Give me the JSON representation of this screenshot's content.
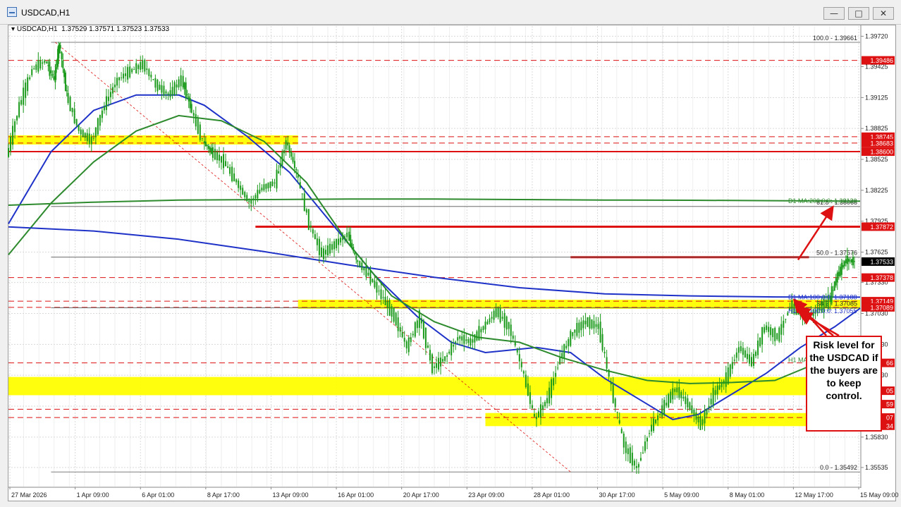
{
  "window": {
    "title": "USDCAD,H1",
    "buttons": {
      "minimize": "—",
      "maximize": "□",
      "close": "✕"
    }
  },
  "chart_header": {
    "symbol": "USDCAD,H1",
    "ohlc": "1.37529 1.37571 1.37523 1.37533"
  },
  "colors": {
    "candle": "#1a9a1a",
    "ma_blue": "#1f32c8",
    "ma_green": "#2d8a2d",
    "support": "#ffff00",
    "level_red": "#dd1111",
    "current_price_bg": "#000000",
    "grid": "#dadada"
  },
  "chart_data": {
    "type": "line",
    "subtype": "candlestick",
    "symbol": "USDCAD",
    "timeframe": "H1",
    "ylim": [
      1.3535,
      1.3975
    ],
    "price_axis_ticks": [
      "1.39720",
      "1.39425",
      "1.39125",
      "1.38825",
      "1.38525",
      "1.38225",
      "1.37925",
      "1.37625",
      "1.37330",
      "1.37030",
      "1.36730",
      "1.36430",
      "1.36130",
      "1.35830",
      "1.35535"
    ],
    "time_labels": [
      "27 Mar 2026",
      "1 Apr 09:00",
      "6 Apr 01:00",
      "8 Apr 17:00",
      "13 Apr 09:00",
      "16 Apr 01:00",
      "20 Apr 17:00",
      "23 Apr 09:00",
      "28 Apr 01:00",
      "30 Apr 17:00",
      "5 May 09:00",
      "8 May 01:00",
      "12 May 17:00",
      "15 May 09:00"
    ],
    "price_series": [
      {
        "t": 0,
        "p": 1.3855
      },
      {
        "t": 0.015,
        "p": 1.3905
      },
      {
        "t": 0.03,
        "p": 1.394
      },
      {
        "t": 0.045,
        "p": 1.3948
      },
      {
        "t": 0.055,
        "p": 1.393
      },
      {
        "t": 0.061,
        "p": 1.3966
      },
      {
        "t": 0.07,
        "p": 1.3915
      },
      {
        "t": 0.085,
        "p": 1.388
      },
      {
        "t": 0.1,
        "p": 1.387
      },
      {
        "t": 0.115,
        "p": 1.3905
      },
      {
        "t": 0.13,
        "p": 1.393
      },
      {
        "t": 0.145,
        "p": 1.3938
      },
      {
        "t": 0.16,
        "p": 1.3945
      },
      {
        "t": 0.175,
        "p": 1.3925
      },
      {
        "t": 0.19,
        "p": 1.3915
      },
      {
        "t": 0.205,
        "p": 1.393
      },
      {
        "t": 0.215,
        "p": 1.3905
      },
      {
        "t": 0.23,
        "p": 1.387
      },
      {
        "t": 0.24,
        "p": 1.386
      },
      {
        "t": 0.255,
        "p": 1.385
      },
      {
        "t": 0.27,
        "p": 1.383
      },
      {
        "t": 0.285,
        "p": 1.381
      },
      {
        "t": 0.3,
        "p": 1.3825
      },
      {
        "t": 0.315,
        "p": 1.383
      },
      {
        "t": 0.328,
        "p": 1.387
      },
      {
        "t": 0.34,
        "p": 1.384
      },
      {
        "t": 0.355,
        "p": 1.379
      },
      {
        "t": 0.37,
        "p": 1.376
      },
      {
        "t": 0.385,
        "p": 1.377
      },
      {
        "t": 0.4,
        "p": 1.378
      },
      {
        "t": 0.41,
        "p": 1.3755
      },
      {
        "t": 0.425,
        "p": 1.374
      },
      {
        "t": 0.44,
        "p": 1.372
      },
      {
        "t": 0.455,
        "p": 1.37
      },
      {
        "t": 0.47,
        "p": 1.367
      },
      {
        "t": 0.485,
        "p": 1.37
      },
      {
        "t": 0.5,
        "p": 1.365
      },
      {
        "t": 0.515,
        "p": 1.366
      },
      {
        "t": 0.53,
        "p": 1.368
      },
      {
        "t": 0.545,
        "p": 1.3675
      },
      {
        "t": 0.56,
        "p": 1.369
      },
      {
        "t": 0.575,
        "p": 1.3705
      },
      {
        "t": 0.59,
        "p": 1.369
      },
      {
        "t": 0.605,
        "p": 1.365
      },
      {
        "t": 0.62,
        "p": 1.36
      },
      {
        "t": 0.635,
        "p": 1.362
      },
      {
        "t": 0.65,
        "p": 1.366
      },
      {
        "t": 0.665,
        "p": 1.3685
      },
      {
        "t": 0.68,
        "p": 1.3695
      },
      {
        "t": 0.695,
        "p": 1.369
      },
      {
        "t": 0.71,
        "p": 1.363
      },
      {
        "t": 0.725,
        "p": 1.3575
      },
      {
        "t": 0.74,
        "p": 1.3552
      },
      {
        "t": 0.755,
        "p": 1.359
      },
      {
        "t": 0.77,
        "p": 1.361
      },
      {
        "t": 0.785,
        "p": 1.363
      },
      {
        "t": 0.8,
        "p": 1.3615
      },
      {
        "t": 0.815,
        "p": 1.3595
      },
      {
        "t": 0.83,
        "p": 1.3625
      },
      {
        "t": 0.845,
        "p": 1.364
      },
      {
        "t": 0.86,
        "p": 1.367
      },
      {
        "t": 0.875,
        "p": 1.3655
      },
      {
        "t": 0.89,
        "p": 1.369
      },
      {
        "t": 0.905,
        "p": 1.368
      },
      {
        "t": 0.92,
        "p": 1.371
      },
      {
        "t": 0.935,
        "p": 1.37
      },
      {
        "t": 0.95,
        "p": 1.3705
      },
      {
        "t": 0.965,
        "p": 1.3715
      },
      {
        "t": 0.975,
        "p": 1.374
      },
      {
        "t": 0.985,
        "p": 1.3755
      },
      {
        "t": 0.995,
        "p": 1.37533
      }
    ],
    "moving_averages": [
      {
        "name": "H1 MA:100",
        "color": "#1f32c8",
        "points": [
          {
            "t": 0,
            "p": 1.379
          },
          {
            "t": 0.05,
            "p": 1.386
          },
          {
            "t": 0.1,
            "p": 1.39
          },
          {
            "t": 0.15,
            "p": 1.3915
          },
          {
            "t": 0.2,
            "p": 1.3915
          },
          {
            "t": 0.23,
            "p": 1.3905
          },
          {
            "t": 0.28,
            "p": 1.3875
          },
          {
            "t": 0.33,
            "p": 1.384
          },
          {
            "t": 0.38,
            "p": 1.379
          },
          {
            "t": 0.43,
            "p": 1.374
          },
          {
            "t": 0.48,
            "p": 1.37
          },
          {
            "t": 0.52,
            "p": 1.3675
          },
          {
            "t": 0.56,
            "p": 1.3665
          },
          {
            "t": 0.62,
            "p": 1.367
          },
          {
            "t": 0.66,
            "p": 1.3665
          },
          {
            "t": 0.7,
            "p": 1.364
          },
          {
            "t": 0.74,
            "p": 1.362
          },
          {
            "t": 0.78,
            "p": 1.36
          },
          {
            "t": 0.81,
            "p": 1.3605
          },
          {
            "t": 0.85,
            "p": 1.3625
          },
          {
            "t": 0.89,
            "p": 1.3645
          },
          {
            "t": 0.93,
            "p": 1.367
          },
          {
            "t": 0.97,
            "p": 1.369
          },
          {
            "t": 1,
            "p": 1.3708
          }
        ]
      },
      {
        "name": "H1 MA:200",
        "color": "#2d8a2d",
        "points": [
          {
            "t": 0,
            "p": 1.376
          },
          {
            "t": 0.05,
            "p": 1.381
          },
          {
            "t": 0.1,
            "p": 1.385
          },
          {
            "t": 0.15,
            "p": 1.388
          },
          {
            "t": 0.2,
            "p": 1.3895
          },
          {
            "t": 0.25,
            "p": 1.389
          },
          {
            "t": 0.3,
            "p": 1.387
          },
          {
            "t": 0.35,
            "p": 1.383
          },
          {
            "t": 0.4,
            "p": 1.377
          },
          {
            "t": 0.45,
            "p": 1.372
          },
          {
            "t": 0.5,
            "p": 1.3695
          },
          {
            "t": 0.55,
            "p": 1.368
          },
          {
            "t": 0.6,
            "p": 1.3675
          },
          {
            "t": 0.65,
            "p": 1.366
          },
          {
            "t": 0.7,
            "p": 1.3648
          },
          {
            "t": 0.75,
            "p": 1.3638
          },
          {
            "t": 0.8,
            "p": 1.3635
          },
          {
            "t": 0.85,
            "p": 1.3636
          },
          {
            "t": 0.9,
            "p": 1.3638
          },
          {
            "t": 0.95,
            "p": 1.3655
          },
          {
            "t": 1,
            "p": 1.368
          }
        ]
      },
      {
        "name": "D1 MA:100",
        "color": "#1f32c8",
        "points": [
          {
            "t": 0,
            "p": 1.3787
          },
          {
            "t": 0.1,
            "p": 1.3783
          },
          {
            "t": 0.2,
            "p": 1.3775
          },
          {
            "t": 0.3,
            "p": 1.3763
          },
          {
            "t": 0.4,
            "p": 1.375
          },
          {
            "t": 0.5,
            "p": 1.3738
          },
          {
            "t": 0.6,
            "p": 1.3728
          },
          {
            "t": 0.7,
            "p": 1.3722
          },
          {
            "t": 0.8,
            "p": 1.372
          },
          {
            "t": 0.9,
            "p": 1.3719
          },
          {
            "t": 1,
            "p": 1.37188
          }
        ]
      },
      {
        "name": "D1 MA:200",
        "color": "#2d8a2d",
        "points": [
          {
            "t": 0,
            "p": 1.3808
          },
          {
            "t": 0.1,
            "p": 1.3811
          },
          {
            "t": 0.2,
            "p": 1.3813
          },
          {
            "t": 0.3,
            "p": 1.38135
          },
          {
            "t": 0.4,
            "p": 1.3814
          },
          {
            "t": 0.5,
            "p": 1.3814
          },
          {
            "t": 0.6,
            "p": 1.38135
          },
          {
            "t": 0.7,
            "p": 1.3813
          },
          {
            "t": 0.8,
            "p": 1.38128
          },
          {
            "t": 0.9,
            "p": 1.38124
          },
          {
            "t": 1,
            "p": 1.3812
          }
        ]
      }
    ],
    "support_zones": [
      {
        "from": 1.38683,
        "to": 1.38745,
        "t_from": 0,
        "t_to": 0.34
      },
      {
        "from": 1.37089,
        "to": 1.37149,
        "t_from": 0.34,
        "t_to": 1
      },
      {
        "from": 1.3625,
        "to": 1.364,
        "t_from": 0,
        "t_to": 1
      },
      {
        "from": 1.3595,
        "to": 1.3605,
        "t_from": 0.56,
        "t_to": 1
      }
    ],
    "horizontal_lines": [
      {
        "price": 1.39486,
        "style": "dash",
        "color": "#dd1111",
        "t_from": 0,
        "t_to": 1
      },
      {
        "price": 1.38745,
        "style": "dash",
        "color": "#dd1111",
        "t_from": 0,
        "t_to": 1
      },
      {
        "price": 1.38683,
        "style": "dash",
        "color": "#dd1111",
        "t_from": 0,
        "t_to": 1
      },
      {
        "price": 1.386,
        "style": "solid",
        "color": "#dd1111",
        "t_from": 0,
        "t_to": 1
      },
      {
        "price": 1.37872,
        "style": "thick",
        "color": "#dd1111",
        "t_from": 0.29,
        "t_to": 1
      },
      {
        "price": 1.37576,
        "style": "thick",
        "color": "#dd1111",
        "t_from": 0.66,
        "t_to": 0.94
      },
      {
        "price": 1.37378,
        "style": "dash",
        "color": "#dd1111",
        "t_from": 0,
        "t_to": 1
      },
      {
        "price": 1.37149,
        "style": "dash",
        "color": "#dd1111",
        "t_from": 0,
        "t_to": 1
      },
      {
        "price": 1.37089,
        "style": "dash",
        "color": "#dd1111",
        "t_from": 0,
        "t_to": 1
      },
      {
        "price": 1.3655,
        "style": "dash",
        "color": "#dd1111",
        "t_from": 0,
        "t_to": 1
      },
      {
        "price": 1.361,
        "style": "dash",
        "color": "#dd1111",
        "t_from": 0,
        "t_to": 1
      },
      {
        "price": 1.3602,
        "style": "dash",
        "color": "#dd1111",
        "t_from": 0,
        "t_to": 1
      }
    ],
    "fibonacci": [
      {
        "price": 1.39661,
        "label": "100.0 - 1.39661"
      },
      {
        "price": 1.38068,
        "label": "61.8 - 1.38068"
      },
      {
        "price": 1.37576,
        "label": "50.0 - 1.37576"
      },
      {
        "price": 1.37085,
        "label": "38.2 - 1.37085"
      },
      {
        "price": 1.35492,
        "label": "0.0 - 1.35492"
      }
    ],
    "ma_labels": [
      {
        "text": "D1 MA:200:0:0: 1.38120",
        "price": 1.3812,
        "color": "#2d8a2d"
      },
      {
        "text": "D1 MA:100:0:0: 1.37188",
        "price": 1.37188,
        "color": "#1f32c8"
      },
      {
        "text": "H1 MA:100:0:0: 1.37055",
        "price": 1.37055,
        "color": "#1f32c8"
      },
      {
        "text": "H1 MA",
        "price": 1.3658,
        "color": "#2d8a2d"
      }
    ],
    "price_tags": [
      {
        "price": 1.39486,
        "label": "1.39486",
        "bg": "#dd1111"
      },
      {
        "price": 1.38745,
        "label": "1.38745",
        "bg": "#dd1111"
      },
      {
        "price": 1.38683,
        "label": "1.38683",
        "bg": "#dd1111"
      },
      {
        "price": 1.386,
        "label": "1.38600",
        "bg": "#dd1111"
      },
      {
        "price": 1.37872,
        "label": "1.37872",
        "bg": "#dd1111"
      },
      {
        "price": 1.37533,
        "label": "1.37533",
        "bg": "#000000"
      },
      {
        "price": 1.37378,
        "label": "1.37378",
        "bg": "#dd1111"
      },
      {
        "price": 1.37149,
        "label": "1.37149",
        "bg": "#dd1111"
      },
      {
        "price": 1.37089,
        "label": "1.37089",
        "bg": "#dd1111"
      },
      {
        "price": 1.3655,
        "label": "66",
        "bg": "#dd1111"
      },
      {
        "price": 1.3628,
        "label": "05",
        "bg": "#dd1111"
      },
      {
        "price": 1.3615,
        "label": "59",
        "bg": "#dd1111"
      },
      {
        "price": 1.3602,
        "label": "07",
        "bg": "#dd1111"
      },
      {
        "price": 1.3594,
        "label": "34",
        "bg": "#dd1111"
      }
    ]
  },
  "annotation": {
    "text": "Risk level for the USDCAD if the buyers are to keep control."
  }
}
